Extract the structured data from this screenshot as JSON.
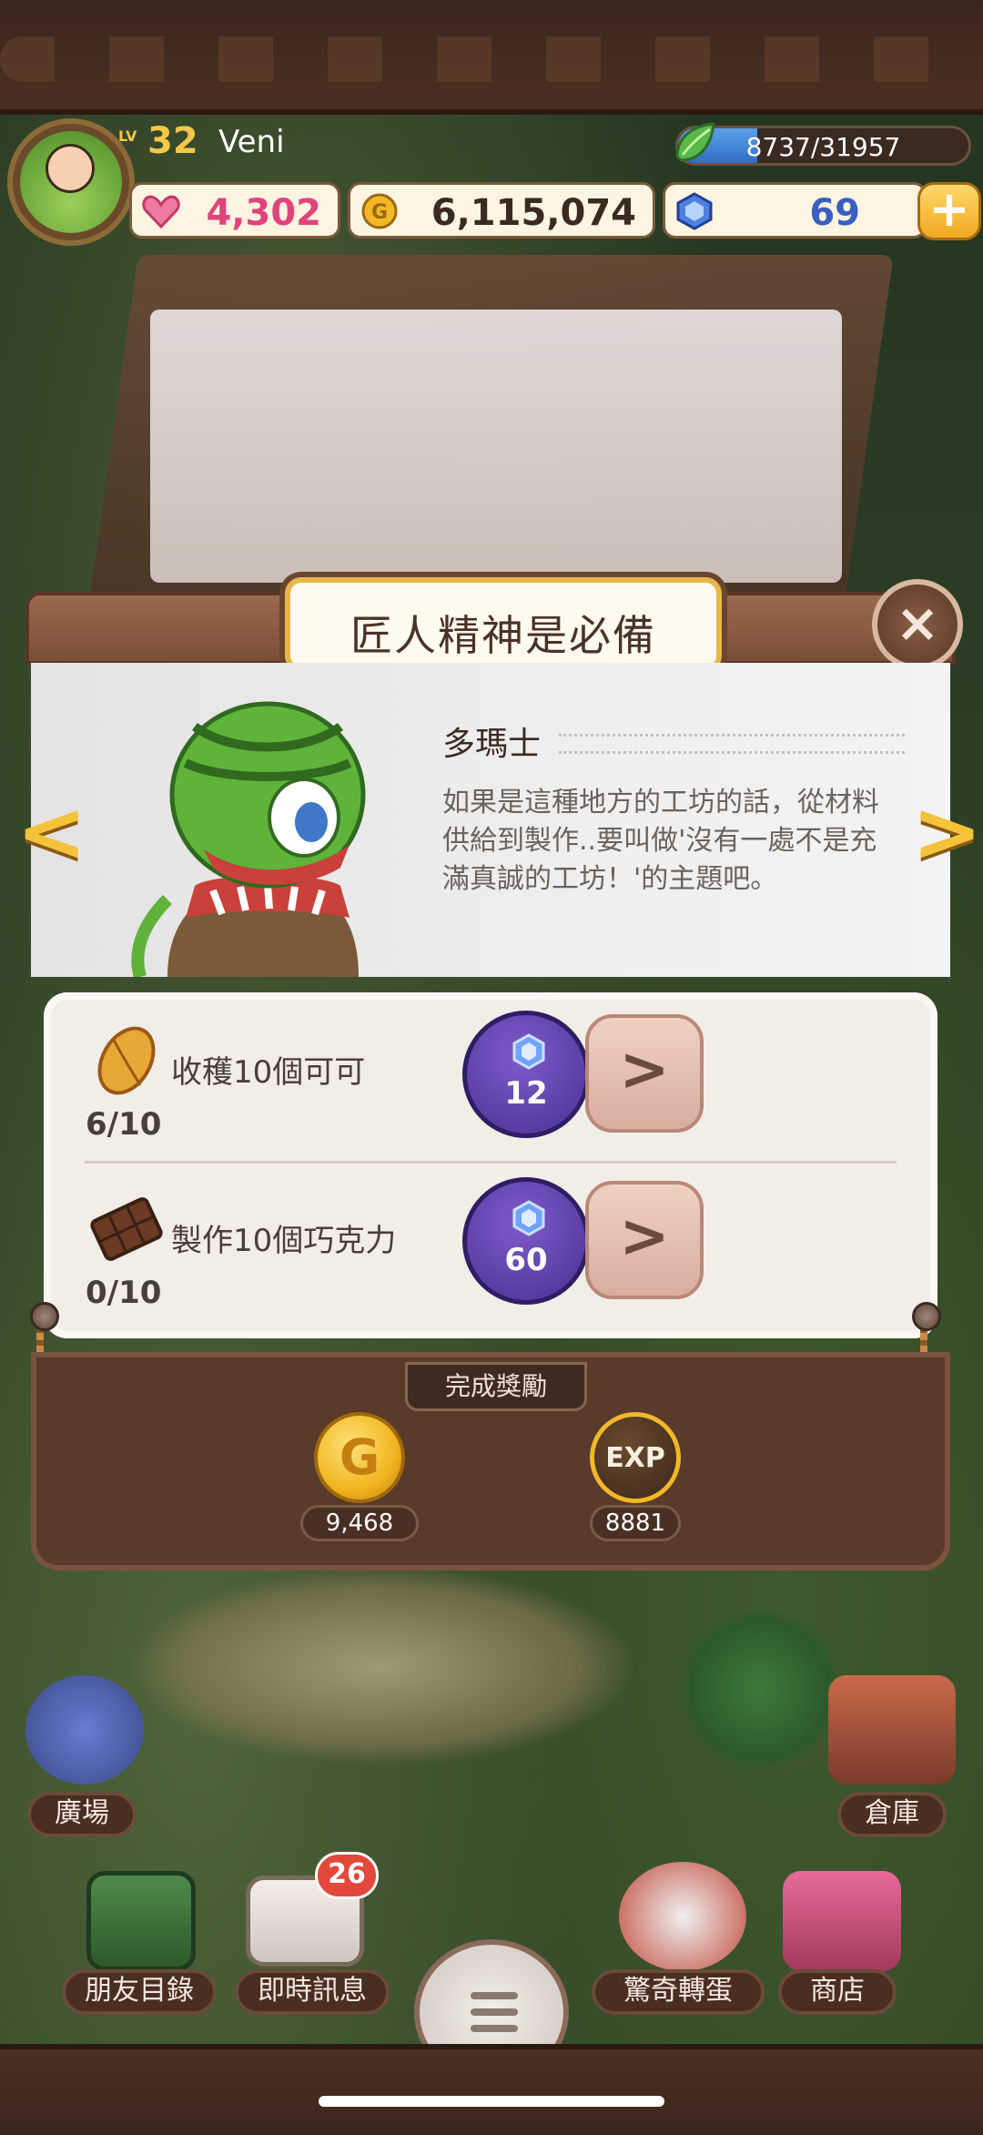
{
  "player": {
    "level_prefix": "LV",
    "level": "32",
    "name": "Veni",
    "exp_text": "8737/31957",
    "exp_fraction": 0.273
  },
  "currencies": {
    "hearts": "4,302",
    "coins": "6,115,074",
    "gems": "69",
    "add_label": "+"
  },
  "dialog": {
    "title": "匠人精神是必備",
    "close_label": "×",
    "speaker": "多瑪士",
    "message_lines": [
      "如果是這種地方的工坊的話，從材料",
      "供給到製作..要叫做'沒有一處不是充",
      "滿真誠的工坊！'的主題吧。"
    ],
    "prev_label": "<",
    "next_label": ">",
    "tasks": [
      {
        "label": "收穫10個可可",
        "progress": "6/10",
        "reward": "12",
        "item_icon": "cocoa-pod-icon"
      },
      {
        "label": "製作10個巧克力",
        "progress": "0/10",
        "reward": "60",
        "item_icon": "chocolate-bar-icon"
      }
    ],
    "go_label": ">",
    "rewards_title": "完成獎勵",
    "coin_label": "G",
    "exp_label": "EXP",
    "reward_coins": "9,468",
    "reward_exp": "8881"
  },
  "nav": {
    "plaza": "廣場",
    "warehouse": "倉庫",
    "friends": "朋友目錄",
    "messages": "即時訊息",
    "messages_badge": "26",
    "gacha": "驚奇轉蛋",
    "shop": "商店"
  },
  "colors": {
    "accent_gold": "#f4c33a",
    "gem_purple": "#5b3aa6",
    "heart_pink": "#e0447a",
    "panel_brown": "#5a3a2a"
  }
}
